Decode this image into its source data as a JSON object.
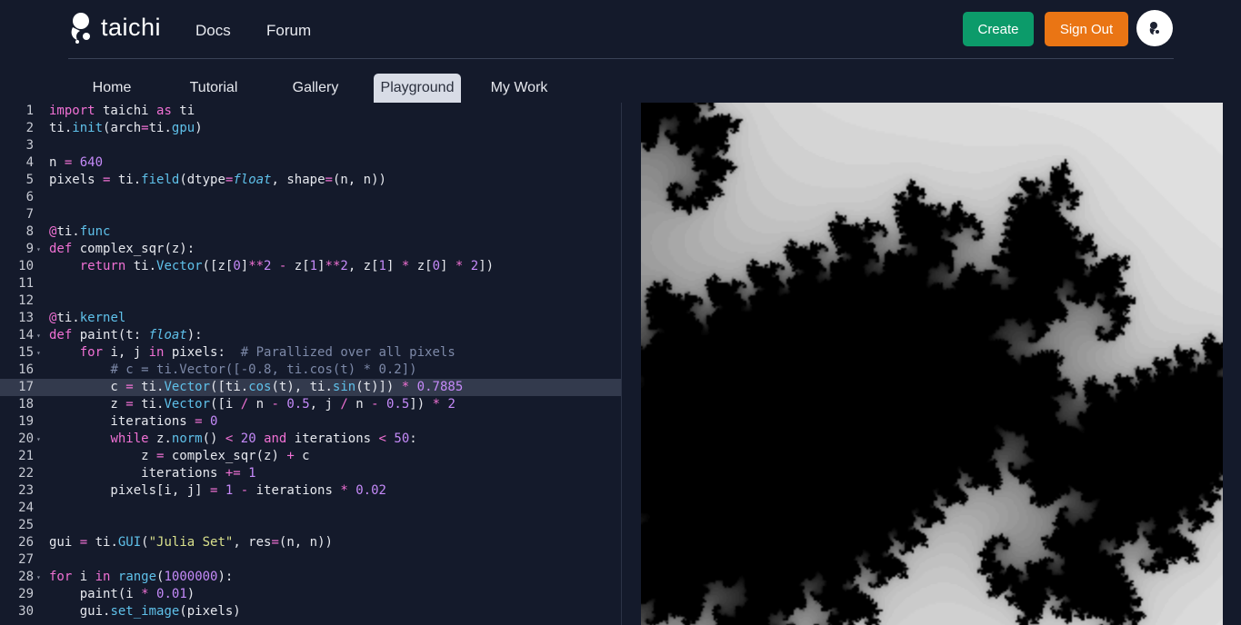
{
  "header": {
    "logo_text": "taichi",
    "nav": [
      "Docs",
      "Forum"
    ],
    "create_label": "Create",
    "signout_label": "Sign Out",
    "create_color": "#0c9b6a",
    "signout_color": "#ea7514"
  },
  "tabs": [
    {
      "label": "Home",
      "active": false
    },
    {
      "label": "Tutorial",
      "active": false
    },
    {
      "label": "Gallery",
      "active": false
    },
    {
      "label": "Playground",
      "active": true
    },
    {
      "label": "My Work",
      "active": false
    }
  ],
  "editor": {
    "highlighted_line": 17,
    "folded_lines": [
      9,
      14,
      15,
      20,
      28
    ],
    "lines": [
      "import taichi as ti",
      "ti.init(arch=ti.gpu)",
      "",
      "n = 640",
      "pixels = ti.field(dtype=float, shape=(n, n))",
      "",
      "",
      "@ti.func",
      "def complex_sqr(z):",
      "    return ti.Vector([z[0]**2 - z[1]**2, z[1] * z[0] * 2])",
      "",
      "",
      "@ti.kernel",
      "def paint(t: float):",
      "    for i, j in pixels:  # Parallized over all pixels",
      "        # c = ti.Vector([-0.8, ti.cos(t) * 0.2])",
      "        c = ti.Vector([ti.cos(t), ti.sin(t)]) * 0.7885",
      "        z = ti.Vector([i / n - 0.5, j / n - 0.5]) * 2",
      "        iterations = 0",
      "        while z.norm() < 20 and iterations < 50:",
      "            z = complex_sqr(z) + c",
      "            iterations += 1",
      "        pixels[i, j] = 1 - iterations * 0.02",
      "",
      "",
      "gui = ti.GUI(\"Julia Set\", res=(n, n))",
      "",
      "for i in range(1000000):",
      "    paint(i * 0.01)",
      "    gui.set_image(pixels)"
    ]
  }
}
